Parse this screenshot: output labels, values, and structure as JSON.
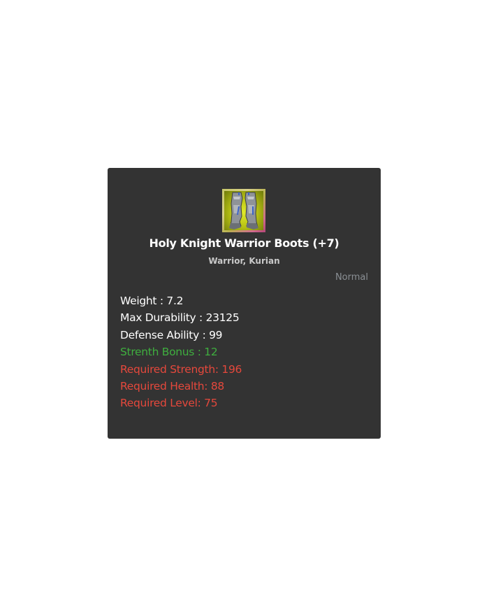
{
  "item": {
    "icon": "boots-icon",
    "name": "Holy Knight Warrior Boots (+7)",
    "classes": "Warrior, Kurian",
    "grade": "Normal",
    "stats": [
      {
        "label": "Weight : 7.2",
        "type": "normal"
      },
      {
        "label": "Max Durability : 23125",
        "type": "normal"
      },
      {
        "label": "Defense Ability : 99",
        "type": "normal"
      },
      {
        "label": "Strenth Bonus : 12",
        "type": "bonus"
      },
      {
        "label": "Required Strength: 196",
        "type": "requirement"
      },
      {
        "label": "Required Health: 88",
        "type": "requirement"
      },
      {
        "label": "Required Level: 75",
        "type": "requirement"
      }
    ]
  },
  "colors": {
    "card_background": "#333333",
    "normal_text": "#ffffff",
    "bonus_text": "#3fae3f",
    "requirement_text": "#e5483c",
    "grade_text": "#8a8f94"
  }
}
